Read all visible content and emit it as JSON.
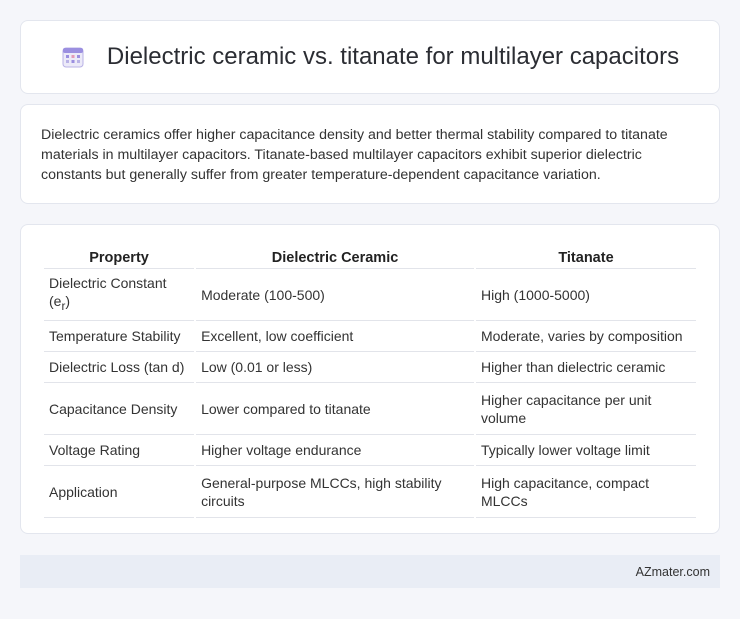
{
  "header": {
    "title": "Dielectric ceramic vs. titanate for multilayer capacitors",
    "icon": "calendar-icon"
  },
  "intro": {
    "text": "Dielectric ceramics offer higher capacitance density and better thermal stability compared to titanate materials in multilayer capacitors. Titanate-based multilayer capacitors exhibit superior dielectric constants but generally suffer from greater temperature-dependent capacitance variation."
  },
  "table": {
    "headers": [
      "Property",
      "Dielectric Ceramic",
      "Titanate"
    ],
    "rows": [
      {
        "property": "Dielectric Constant (e",
        "property_sub": "r",
        "property_tail": ")",
        "ceramic": "Moderate (100-500)",
        "titanate": "High (1000-5000)"
      },
      {
        "property": "Temperature Stability",
        "ceramic": "Excellent, low coefficient",
        "titanate": "Moderate, varies by composition"
      },
      {
        "property": "Dielectric Loss (tan d)",
        "ceramic": "Low (0.01 or less)",
        "titanate": "Higher than dielectric ceramic"
      },
      {
        "property": "Capacitance Density",
        "ceramic": "Lower compared to titanate",
        "titanate": "Higher capacitance per unit volume"
      },
      {
        "property": "Voltage Rating",
        "ceramic": "Higher voltage endurance",
        "titanate": "Typically lower voltage limit"
      },
      {
        "property": "Application",
        "ceramic": "General-purpose MLCCs, high stability circuits",
        "titanate": "High capacitance, compact MLCCs"
      }
    ]
  },
  "footer": {
    "site": "AZmater.com"
  },
  "colors": {
    "background": "#f5f6fa",
    "card": "#ffffff",
    "footer": "#e9edf5",
    "icon_accent": "#8e7fd6"
  }
}
